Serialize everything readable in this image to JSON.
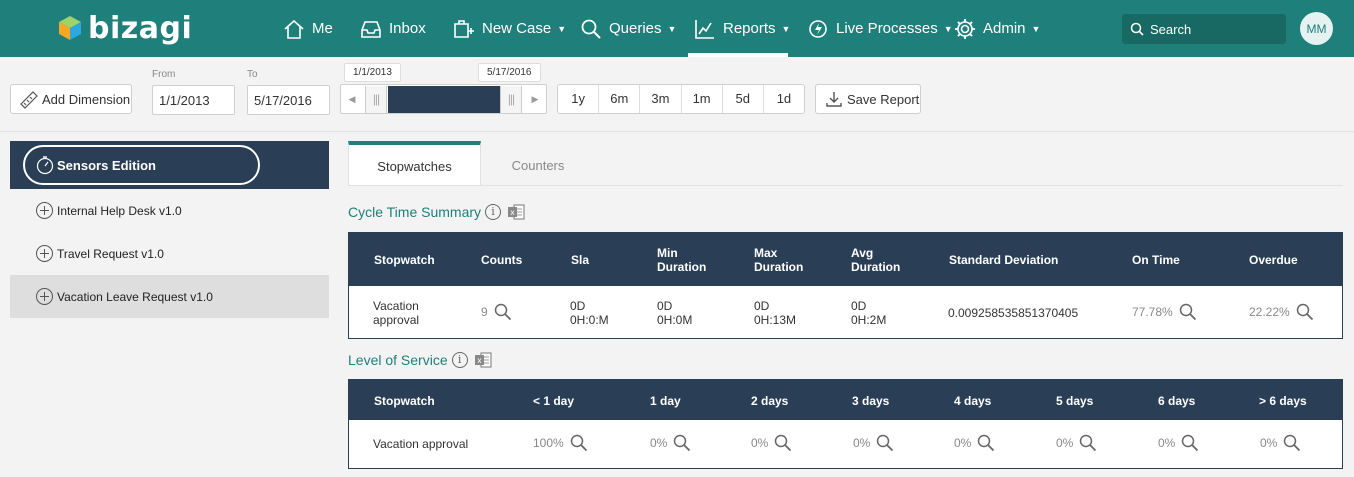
{
  "nav": {
    "logo": "bizagi",
    "items": [
      {
        "label": "Me",
        "icon": "home-icon"
      },
      {
        "label": "Inbox",
        "icon": "inbox-icon"
      },
      {
        "label": "New Case",
        "icon": "new-case-icon",
        "caret": true
      },
      {
        "label": "Queries",
        "icon": "search-icon",
        "caret": true
      },
      {
        "label": "Reports",
        "icon": "reports-icon",
        "caret": true,
        "active": true
      },
      {
        "label": "Live Processes",
        "icon": "live-processes-icon",
        "caret": true
      },
      {
        "label": "Admin",
        "icon": "gear-icon",
        "caret": true
      }
    ],
    "search_placeholder": "Search",
    "avatar_initials": "MM",
    "colors": {
      "bar": "#1e7f7b",
      "dark": "#2a3f56"
    }
  },
  "toolbar": {
    "add_dimension": "Add Dimension",
    "from_label": "From",
    "to_label": "To",
    "from_value": "1/1/2013",
    "to_value": "5/17/2016",
    "range_start_tip": "1/1/2013",
    "range_end_tip": "5/17/2016",
    "zoom": [
      "1y",
      "6m",
      "3m",
      "1m",
      "5d",
      "1d"
    ],
    "save_report": "Save Report"
  },
  "sidebar": {
    "header": "Sensors Edition",
    "items": [
      {
        "label": "Internal Help Desk v1.0"
      },
      {
        "label": "Travel Request v1.0"
      },
      {
        "label": "Vacation Leave Request v1.0",
        "selected": true
      }
    ]
  },
  "tabs": {
    "stopwatches": "Stopwatches",
    "counters": "Counters"
  },
  "cycle": {
    "title": "Cycle Time Summary",
    "headers": {
      "stopwatch": "Stopwatch",
      "counts": "Counts",
      "sla": "Sla",
      "min1": "Min",
      "min2": "Duration",
      "max1": "Max",
      "max2": "Duration",
      "avg1": "Avg",
      "avg2": "Duration",
      "std": "Standard Deviation",
      "ontime": "On Time",
      "overdue": "Overdue"
    },
    "row": {
      "stopwatch1": "Vacation",
      "stopwatch2": "approval",
      "counts": "9",
      "sla1": "0D",
      "sla2": "0H:0:M",
      "min1": "0D",
      "min2": "0H:0M",
      "max1": "0D",
      "max2": "0H:13M",
      "avg1": "0D",
      "avg2": "0H:2M",
      "std": "0.009258535851370405",
      "ontime": "77.78%",
      "overdue": "22.22%"
    }
  },
  "los": {
    "title": "Level of Service",
    "headers": [
      "Stopwatch",
      "< 1 day",
      "1 day",
      "2 days",
      "3 days",
      "4 days",
      "5 days",
      "6 days",
      "> 6 days"
    ],
    "row": {
      "stopwatch": "Vacation approval",
      "values": [
        "100%",
        "0%",
        "0%",
        "0%",
        "0%",
        "0%",
        "0%",
        "0%"
      ]
    }
  }
}
